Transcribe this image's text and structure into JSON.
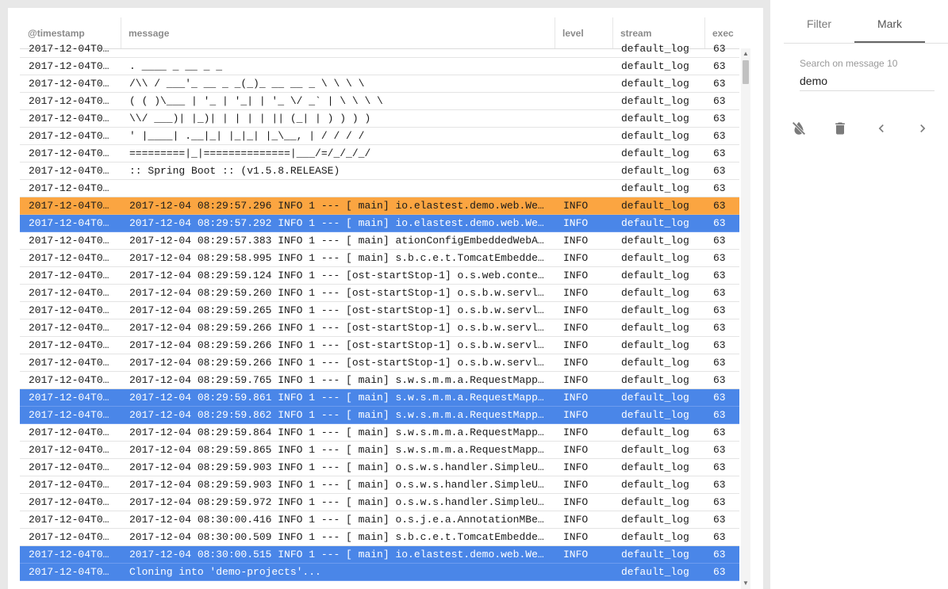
{
  "table": {
    "columns": {
      "timestamp": "@timestamp",
      "message": "message",
      "level": "level",
      "stream": "stream",
      "exec": "exec"
    },
    "rows": [
      {
        "ts": "2017-12-04T0…",
        "msg": "",
        "level": "",
        "stream": "default_log",
        "exec": "63",
        "sel": ""
      },
      {
        "ts": "2017-12-04T0…",
        "msg": ". ____ _ __ _ _",
        "level": "",
        "stream": "default_log",
        "exec": "63",
        "sel": ""
      },
      {
        "ts": "2017-12-04T0…",
        "msg": "/\\\\ / ___'_ __ _ _(_)_ __ __ _ \\ \\ \\ \\",
        "level": "",
        "stream": "default_log",
        "exec": "63",
        "sel": ""
      },
      {
        "ts": "2017-12-04T0…",
        "msg": "( ( )\\___ | '_ | '_| | '_ \\/ _` | \\ \\ \\ \\",
        "level": "",
        "stream": "default_log",
        "exec": "63",
        "sel": ""
      },
      {
        "ts": "2017-12-04T0…",
        "msg": "\\\\/ ___)| |_)| | | | | || (_| | ) ) ) )",
        "level": "",
        "stream": "default_log",
        "exec": "63",
        "sel": ""
      },
      {
        "ts": "2017-12-04T0…",
        "msg": "' |____| .__|_| |_|_| |_\\__, | / / / /",
        "level": "",
        "stream": "default_log",
        "exec": "63",
        "sel": ""
      },
      {
        "ts": "2017-12-04T0…",
        "msg": "=========|_|==============|___/=/_/_/_/",
        "level": "",
        "stream": "default_log",
        "exec": "63",
        "sel": ""
      },
      {
        "ts": "2017-12-04T0…",
        "msg": ":: Spring Boot :: (v1.5.8.RELEASE)",
        "level": "",
        "stream": "default_log",
        "exec": "63",
        "sel": ""
      },
      {
        "ts": "2017-12-04T0…",
        "msg": "",
        "level": "",
        "stream": "default_log",
        "exec": "63",
        "sel": ""
      },
      {
        "ts": "2017-12-04T0…",
        "msg": "2017-12-04 08:29:57.296 INFO 1 --- [ main] io.elastest.demo.web.We…",
        "level": "INFO",
        "stream": "default_log",
        "exec": "63",
        "sel": "orange"
      },
      {
        "ts": "2017-12-04T0…",
        "msg": "2017-12-04 08:29:57.292 INFO 1 --- [ main] io.elastest.demo.web.We…",
        "level": "INFO",
        "stream": "default_log",
        "exec": "63",
        "sel": "blue"
      },
      {
        "ts": "2017-12-04T0…",
        "msg": "2017-12-04 08:29:57.383 INFO 1 --- [ main] ationConfigEmbeddedWebA…",
        "level": "INFO",
        "stream": "default_log",
        "exec": "63",
        "sel": ""
      },
      {
        "ts": "2017-12-04T0…",
        "msg": "2017-12-04 08:29:58.995 INFO 1 --- [ main] s.b.c.e.t.TomcatEmbedde…",
        "level": "INFO",
        "stream": "default_log",
        "exec": "63",
        "sel": ""
      },
      {
        "ts": "2017-12-04T0…",
        "msg": "2017-12-04 08:29:59.124 INFO 1 --- [ost-startStop-1] o.s.web.conte…",
        "level": "INFO",
        "stream": "default_log",
        "exec": "63",
        "sel": ""
      },
      {
        "ts": "2017-12-04T0…",
        "msg": "2017-12-04 08:29:59.260 INFO 1 --- [ost-startStop-1] o.s.b.w.servl…",
        "level": "INFO",
        "stream": "default_log",
        "exec": "63",
        "sel": ""
      },
      {
        "ts": "2017-12-04T0…",
        "msg": "2017-12-04 08:29:59.265 INFO 1 --- [ost-startStop-1] o.s.b.w.servl…",
        "level": "INFO",
        "stream": "default_log",
        "exec": "63",
        "sel": ""
      },
      {
        "ts": "2017-12-04T0…",
        "msg": "2017-12-04 08:29:59.266 INFO 1 --- [ost-startStop-1] o.s.b.w.servl…",
        "level": "INFO",
        "stream": "default_log",
        "exec": "63",
        "sel": ""
      },
      {
        "ts": "2017-12-04T0…",
        "msg": "2017-12-04 08:29:59.266 INFO 1 --- [ost-startStop-1] o.s.b.w.servl…",
        "level": "INFO",
        "stream": "default_log",
        "exec": "63",
        "sel": ""
      },
      {
        "ts": "2017-12-04T0…",
        "msg": "2017-12-04 08:29:59.266 INFO 1 --- [ost-startStop-1] o.s.b.w.servl…",
        "level": "INFO",
        "stream": "default_log",
        "exec": "63",
        "sel": ""
      },
      {
        "ts": "2017-12-04T0…",
        "msg": "2017-12-04 08:29:59.765 INFO 1 --- [ main] s.w.s.m.m.a.RequestMapp…",
        "level": "INFO",
        "stream": "default_log",
        "exec": "63",
        "sel": ""
      },
      {
        "ts": "2017-12-04T0…",
        "msg": "2017-12-04 08:29:59.861 INFO 1 --- [ main] s.w.s.m.m.a.RequestMapp…",
        "level": "INFO",
        "stream": "default_log",
        "exec": "63",
        "sel": "blue"
      },
      {
        "ts": "2017-12-04T0…",
        "msg": "2017-12-04 08:29:59.862 INFO 1 --- [ main] s.w.s.m.m.a.RequestMapp…",
        "level": "INFO",
        "stream": "default_log",
        "exec": "63",
        "sel": "blue"
      },
      {
        "ts": "2017-12-04T0…",
        "msg": "2017-12-04 08:29:59.864 INFO 1 --- [ main] s.w.s.m.m.a.RequestMapp…",
        "level": "INFO",
        "stream": "default_log",
        "exec": "63",
        "sel": ""
      },
      {
        "ts": "2017-12-04T0…",
        "msg": "2017-12-04 08:29:59.865 INFO 1 --- [ main] s.w.s.m.m.a.RequestMapp…",
        "level": "INFO",
        "stream": "default_log",
        "exec": "63",
        "sel": ""
      },
      {
        "ts": "2017-12-04T0…",
        "msg": "2017-12-04 08:29:59.903 INFO 1 --- [ main] o.s.w.s.handler.SimpleU…",
        "level": "INFO",
        "stream": "default_log",
        "exec": "63",
        "sel": ""
      },
      {
        "ts": "2017-12-04T0…",
        "msg": "2017-12-04 08:29:59.903 INFO 1 --- [ main] o.s.w.s.handler.SimpleU…",
        "level": "INFO",
        "stream": "default_log",
        "exec": "63",
        "sel": ""
      },
      {
        "ts": "2017-12-04T0…",
        "msg": "2017-12-04 08:29:59.972 INFO 1 --- [ main] o.s.w.s.handler.SimpleU…",
        "level": "INFO",
        "stream": "default_log",
        "exec": "63",
        "sel": ""
      },
      {
        "ts": "2017-12-04T0…",
        "msg": "2017-12-04 08:30:00.416 INFO 1 --- [ main] o.s.j.e.a.AnnotationMBe…",
        "level": "INFO",
        "stream": "default_log",
        "exec": "63",
        "sel": ""
      },
      {
        "ts": "2017-12-04T0…",
        "msg": "2017-12-04 08:30:00.509 INFO 1 --- [ main] s.b.c.e.t.TomcatEmbedde…",
        "level": "INFO",
        "stream": "default_log",
        "exec": "63",
        "sel": ""
      },
      {
        "ts": "2017-12-04T0…",
        "msg": "2017-12-04 08:30:00.515 INFO 1 --- [ main] io.elastest.demo.web.We…",
        "level": "INFO",
        "stream": "default_log",
        "exec": "63",
        "sel": "blue"
      },
      {
        "ts": "2017-12-04T0…",
        "msg": "Cloning into 'demo-projects'...",
        "level": "",
        "stream": "default_log",
        "exec": "63",
        "sel": "blue"
      }
    ]
  },
  "panel": {
    "tabs": {
      "filter": "Filter",
      "mark": "Mark"
    },
    "active_tab": "Mark",
    "search": {
      "label": "Search on message 10",
      "value": "demo"
    },
    "actions": [
      "clear-marks-icon",
      "delete-icon",
      "chevron-left-icon",
      "chevron-right-icon"
    ]
  },
  "colors": {
    "selected_blue": "#4a86e8",
    "selected_orange": "#fba541",
    "header_text": "#8a8a8a"
  }
}
